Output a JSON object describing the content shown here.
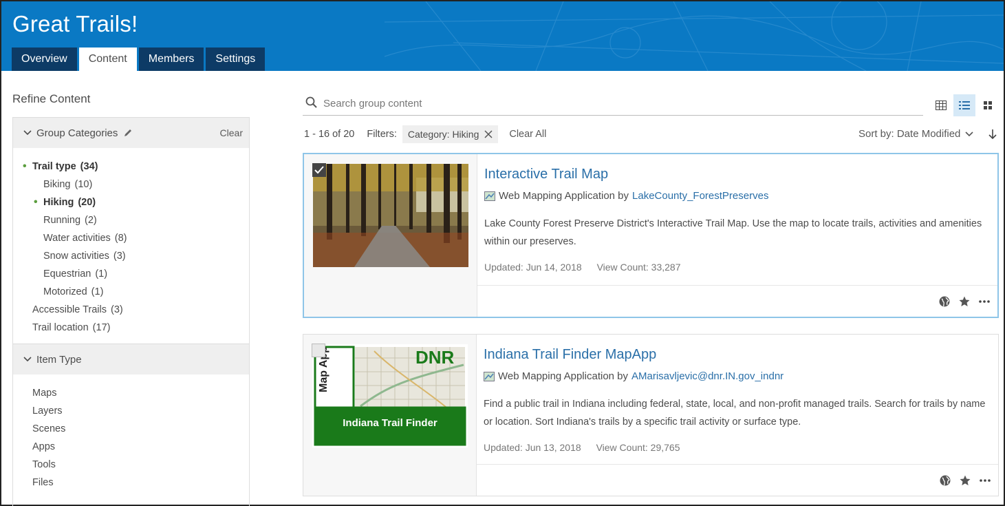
{
  "header": {
    "title": "Great Trails!",
    "tabs": [
      {
        "label": "Overview",
        "active": false
      },
      {
        "label": "Content",
        "active": true
      },
      {
        "label": "Members",
        "active": false
      },
      {
        "label": "Settings",
        "active": false
      }
    ]
  },
  "sidebar": {
    "title": "Refine Content",
    "group_categories": {
      "label": "Group Categories",
      "clear_label": "Clear",
      "items": [
        {
          "label": "Trail type",
          "count": "(34)"
        },
        {
          "label": "Biking",
          "count": "(10)"
        },
        {
          "label": "Hiking",
          "count": "(20)"
        },
        {
          "label": "Running",
          "count": "(2)"
        },
        {
          "label": "Water activities",
          "count": "(8)"
        },
        {
          "label": "Snow activities",
          "count": "(3)"
        },
        {
          "label": "Equestrian",
          "count": "(1)"
        },
        {
          "label": "Motorized",
          "count": "(1)"
        },
        {
          "label": "Accessible Trails",
          "count": "(3)"
        },
        {
          "label": "Trail location",
          "count": "(17)"
        }
      ]
    },
    "item_type": {
      "label": "Item Type",
      "items": [
        "Maps",
        "Layers",
        "Scenes",
        "Apps",
        "Tools",
        "Files"
      ]
    }
  },
  "search": {
    "placeholder": "Search group content"
  },
  "results": {
    "range": "1 - 16 of 20",
    "filters_label": "Filters:",
    "chip": "Category: Hiking",
    "clear_all": "Clear All",
    "sort_label": "Sort by: Date Modified"
  },
  "items": [
    {
      "title": "Interactive Trail Map",
      "type": "Web Mapping Application by",
      "owner": "LakeCounty_ForestPreserves",
      "description": "Lake County Forest Preserve District's Interactive Trail Map. Use the map to locate trails, activities and amenities within our preserves.",
      "updated": "Updated: Jun 14, 2018",
      "views": "View Count: 33,287"
    },
    {
      "title": "Indiana Trail Finder MapApp",
      "type": "Web Mapping Application by",
      "owner": "AMarisavljevic@dnr.IN.gov_indnr",
      "description": "Find a public trail in Indiana including federal, state, local, and non-profit managed trails. Search for trails by name or location. Sort Indiana's trails by a specific trail activity or surface type.",
      "updated": "Updated: Jun 13, 2018",
      "views": "View Count: 29,765",
      "thumb_text": {
        "side": "Map App",
        "brand": "DNR",
        "banner": "Indiana Trail Finder"
      }
    }
  ],
  "colors": {
    "header": "#0a79c4",
    "tab_dark": "#0d3b66",
    "link": "#2a6fa8",
    "dot": "#5b9e3e",
    "dnr_green": "#1a7a1a"
  }
}
